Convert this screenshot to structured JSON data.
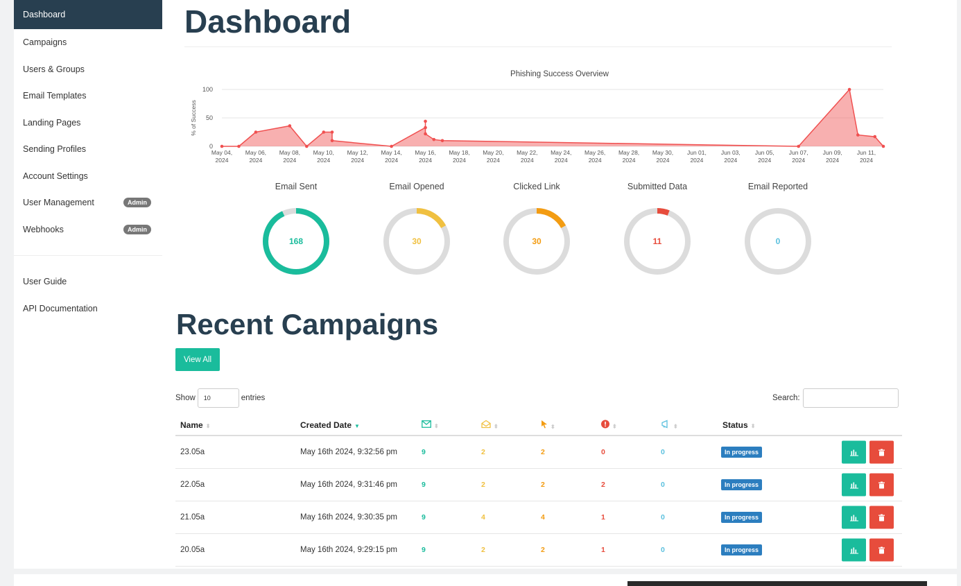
{
  "sidebar": {
    "items": [
      {
        "label": "Dashboard",
        "active": true
      },
      {
        "label": "Campaigns"
      },
      {
        "label": "Users & Groups"
      },
      {
        "label": "Email Templates"
      },
      {
        "label": "Landing Pages"
      },
      {
        "label": "Sending Profiles"
      },
      {
        "label": "Account Settings"
      },
      {
        "label": "User Management",
        "badge": "Admin"
      },
      {
        "label": "Webhooks",
        "badge": "Admin"
      }
    ],
    "secondary": [
      {
        "label": "User Guide"
      },
      {
        "label": "API Documentation"
      }
    ]
  },
  "page": {
    "title": "Dashboard"
  },
  "chart_data": {
    "type": "area",
    "title": "Phishing Success Overview",
    "ylabel": "% of Success",
    "xlabel": "",
    "ylim": [
      0,
      100
    ],
    "yticks": [
      0,
      50,
      100
    ],
    "grid": true,
    "color": "#f05050",
    "xticks": [
      "May 04, 2024",
      "May 06, 2024",
      "May 08, 2024",
      "May 10, 2024",
      "May 12, 2024",
      "May 14, 2024",
      "May 16, 2024",
      "May 18, 2024",
      "May 20, 2024",
      "May 22, 2024",
      "May 24, 2024",
      "May 26, 2024",
      "May 28, 2024",
      "May 30, 2024",
      "Jun 01, 2024",
      "Jun 03, 2024",
      "Jun 05, 2024",
      "Jun 07, 2024",
      "Jun 09, 2024",
      "Jun 11, 2024"
    ],
    "points": [
      {
        "x": "2024-05-04",
        "y": 0
      },
      {
        "x": "2024-05-05",
        "y": 0
      },
      {
        "x": "2024-05-06",
        "y": 25
      },
      {
        "x": "2024-05-08",
        "y": 36
      },
      {
        "x": "2024-05-09",
        "y": 0
      },
      {
        "x": "2024-05-10",
        "y": 25
      },
      {
        "x": "2024-05-10T12:00",
        "y": 25
      },
      {
        "x": "2024-05-10T12:00",
        "y": 10
      },
      {
        "x": "2024-05-14",
        "y": 0
      },
      {
        "x": "2024-05-16",
        "y": 33
      },
      {
        "x": "2024-05-16",
        "y": 44
      },
      {
        "x": "2024-05-16",
        "y": 22
      },
      {
        "x": "2024-05-16T12:00",
        "y": 12
      },
      {
        "x": "2024-05-17",
        "y": 10
      },
      {
        "x": "2024-06-07",
        "y": 0
      },
      {
        "x": "2024-06-10",
        "y": 100
      },
      {
        "x": "2024-06-10T12:00",
        "y": 20
      },
      {
        "x": "2024-06-11T12:00",
        "y": 17
      },
      {
        "x": "2024-06-12",
        "y": 0
      }
    ]
  },
  "stats": [
    {
      "label": "Email Sent",
      "value": "168",
      "percent": 93,
      "color": "#1abc9c"
    },
    {
      "label": "Email Opened",
      "value": "30",
      "percent": 17,
      "color": "#f0c040"
    },
    {
      "label": "Clicked Link",
      "value": "30",
      "percent": 17,
      "color": "#f39c12"
    },
    {
      "label": "Submitted Data",
      "value": "11",
      "percent": 6,
      "color": "#e74c3c"
    },
    {
      "label": "Email Reported",
      "value": "0",
      "percent": 0,
      "color": "#5bc0de"
    }
  ],
  "recent": {
    "title": "Recent Campaigns",
    "view_all": "View All",
    "show_label": "Show",
    "show_value": "10",
    "entries_label": "entries",
    "search_label": "Search:",
    "columns": {
      "name": "Name",
      "created": "Created Date",
      "status": "Status"
    },
    "icon_colors": {
      "sent": "#1abc9c",
      "opened": "#f0c040",
      "clicked": "#f39c12",
      "submitted": "#e74c3c",
      "reported": "#5bc0de"
    },
    "rows": [
      {
        "name": "23.05a",
        "created": "May 16th 2024, 9:32:56 pm",
        "sent": "9",
        "opened": "2",
        "clicked": "2",
        "submitted": "0",
        "reported": "0",
        "status": "In progress"
      },
      {
        "name": "22.05a",
        "created": "May 16th 2024, 9:31:46 pm",
        "sent": "9",
        "opened": "2",
        "clicked": "2",
        "submitted": "2",
        "reported": "0",
        "status": "In progress"
      },
      {
        "name": "21.05a",
        "created": "May 16th 2024, 9:30:35 pm",
        "sent": "9",
        "opened": "4",
        "clicked": "4",
        "submitted": "1",
        "reported": "0",
        "status": "In progress"
      },
      {
        "name": "20.05a",
        "created": "May 16th 2024, 9:29:15 pm",
        "sent": "9",
        "opened": "2",
        "clicked": "2",
        "submitted": "1",
        "reported": "0",
        "status": "In progress"
      }
    ]
  }
}
